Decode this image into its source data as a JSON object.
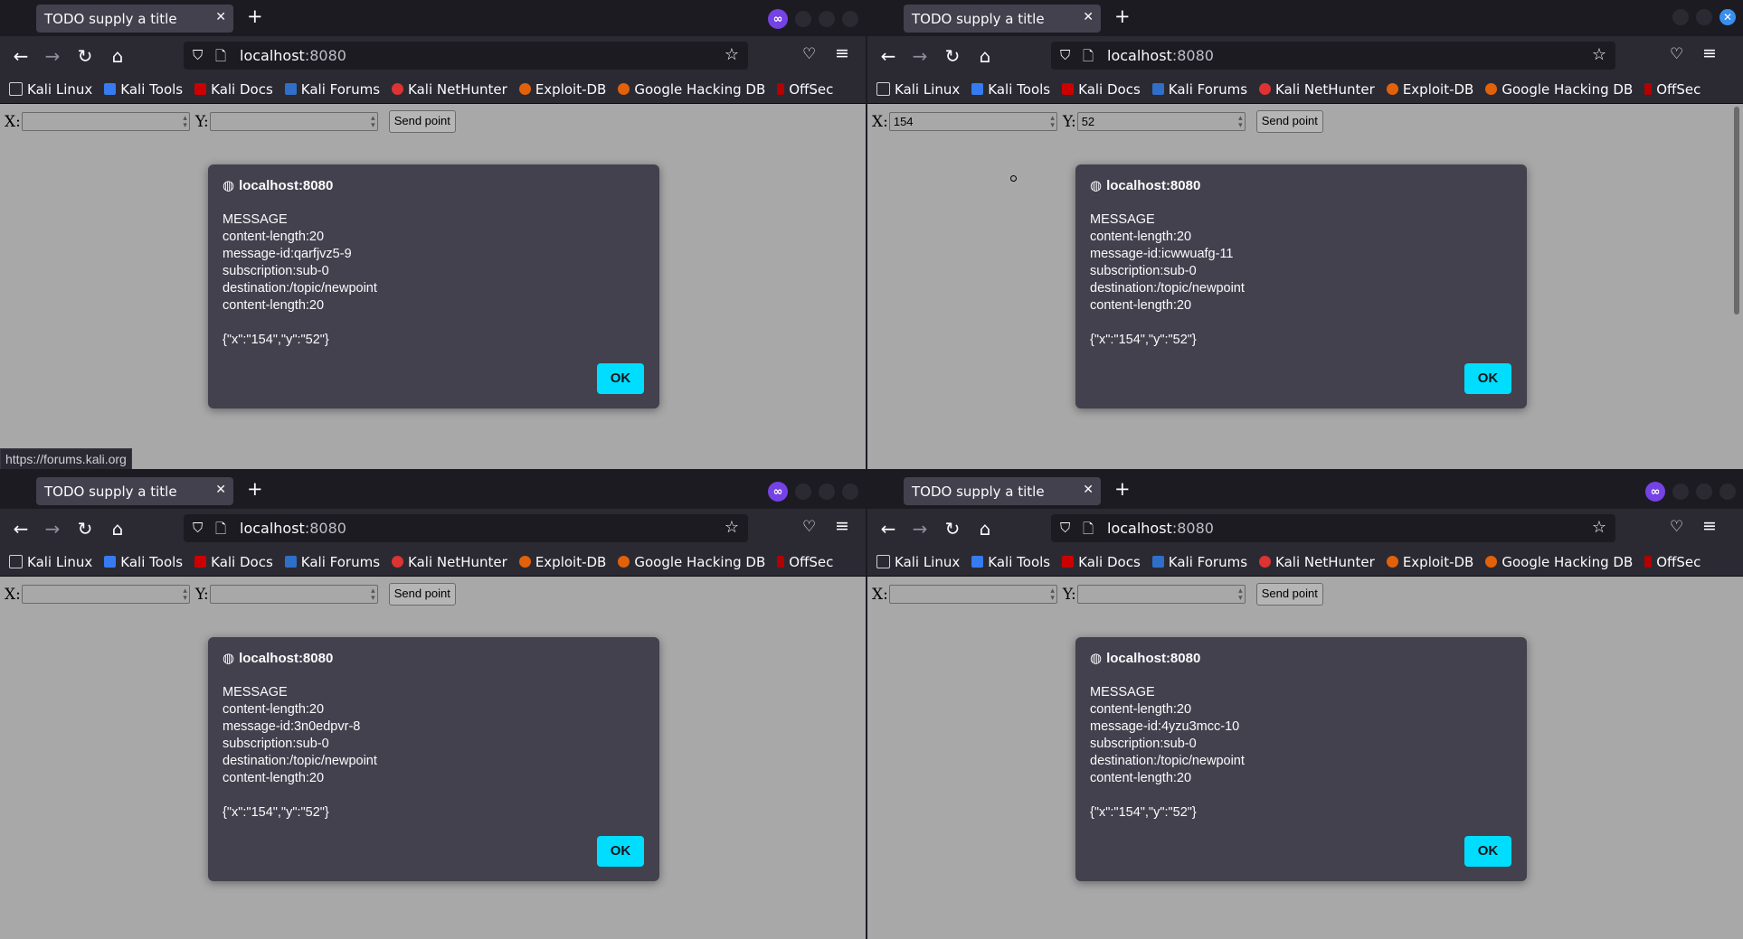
{
  "windows": [
    {
      "tab_title": "TODO supply a title",
      "url_host": "localhost",
      "url_port": ":8080",
      "bookmarks": [
        "Kali Linux",
        "Kali Tools",
        "Kali Docs",
        "Kali Forums",
        "Kali NetHunter",
        "Exploit-DB",
        "Google Hacking DB",
        "OffSec"
      ],
      "form": {
        "x_label": "X:",
        "y_label": "Y:",
        "x_value": "",
        "y_value": "",
        "send_label": "Send point"
      },
      "dialog": {
        "origin": "localhost:8080",
        "lines": [
          "MESSAGE",
          "content-length:20",
          "message-id:qarfjvz5-9",
          "subscription:sub-0",
          "destination:/topic/newpoint",
          "content-length:20",
          "",
          "{\"x\":\"154\",\"y\":\"52\"}"
        ],
        "ok_label": "OK"
      },
      "status_url": "https://forums.kali.org"
    },
    {
      "tab_title": "TODO supply a title",
      "url_host": "localhost",
      "url_port": ":8080",
      "bookmarks": [
        "Kali Linux",
        "Kali Tools",
        "Kali Docs",
        "Kali Forums",
        "Kali NetHunter",
        "Exploit-DB",
        "Google Hacking DB",
        "OffSec"
      ],
      "form": {
        "x_label": "X:",
        "y_label": "Y:",
        "x_value": "154",
        "y_value": "52",
        "send_label": "Send point"
      },
      "dialog": {
        "origin": "localhost:8080",
        "lines": [
          "MESSAGE",
          "content-length:20",
          "message-id:icwwuafg-11",
          "subscription:sub-0",
          "destination:/topic/newpoint",
          "content-length:20",
          "",
          "{\"x\":\"154\",\"y\":\"52\"}"
        ],
        "ok_label": "OK"
      }
    },
    {
      "tab_title": "TODO supply a title",
      "url_host": "localhost",
      "url_port": ":8080",
      "bookmarks": [
        "Kali Linux",
        "Kali Tools",
        "Kali Docs",
        "Kali Forums",
        "Kali NetHunter",
        "Exploit-DB",
        "Google Hacking DB",
        "OffSec"
      ],
      "form": {
        "x_label": "X:",
        "y_label": "Y:",
        "x_value": "",
        "y_value": "",
        "send_label": "Send point"
      },
      "dialog": {
        "origin": "localhost:8080",
        "lines": [
          "MESSAGE",
          "content-length:20",
          "message-id:3n0edpvr-8",
          "subscription:sub-0",
          "destination:/topic/newpoint",
          "content-length:20",
          "",
          "{\"x\":\"154\",\"y\":\"52\"}"
        ],
        "ok_label": "OK"
      }
    },
    {
      "tab_title": "TODO supply a title",
      "url_host": "localhost",
      "url_port": ":8080",
      "bookmarks": [
        "Kali Linux",
        "Kali Tools",
        "Kali Docs",
        "Kali Forums",
        "Kali NetHunter",
        "Exploit-DB",
        "Google Hacking DB",
        "OffSec"
      ],
      "form": {
        "x_label": "X:",
        "y_label": "Y:",
        "x_value": "",
        "y_value": "",
        "send_label": "Send point"
      },
      "dialog": {
        "origin": "localhost:8080",
        "lines": [
          "MESSAGE",
          "content-length:20",
          "message-id:4yzu3mcc-10",
          "subscription:sub-0",
          "destination:/topic/newpoint",
          "content-length:20",
          "",
          "{\"x\":\"154\",\"y\":\"52\"}"
        ],
        "ok_label": "OK"
      }
    }
  ],
  "icons": {
    "back": "arrow-left-icon",
    "forward": "arrow-right-icon",
    "reload": "reload-icon",
    "home": "home-icon",
    "shield": "shield-icon",
    "page": "page-icon",
    "star": "star-icon",
    "pocket": "pocket-icon",
    "menu": "hamburger-menu-icon",
    "globe": "globe-icon",
    "private": "private-browsing-icon"
  },
  "colors": {
    "toolbar": "#2b2a33",
    "tabbar": "#1c1b22",
    "dialog": "#42414d",
    "ok_button": "#00ddff",
    "page": "#a8a8a8"
  }
}
